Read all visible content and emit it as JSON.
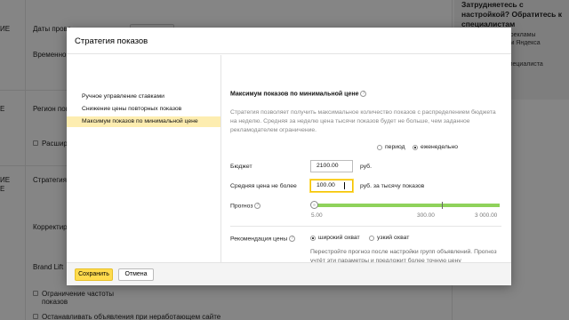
{
  "background": {
    "col1": [
      "ИЕ",
      "Е",
      "ИЕ",
      "Е"
    ],
    "labels": {
      "dates": "Даты прове",
      "time": "Временно",
      "region": "Регион показ",
      "expand": "Расшире",
      "strategy": "Стратегия",
      "adjust": "Корректир",
      "brandlift": "Brand Lift",
      "freq_line1": "Ограничение частоты",
      "freq_line2": "показов",
      "stop": "Останавливать объявления при неработающем сайте"
    },
    "help": {
      "title": "Затрудняетесь с настройкой? Обратитесь к специалистам",
      "item1": "…настройку рекламы специалистам Яндекса",
      "item2": "…частного специалиста"
    }
  },
  "modal": {
    "title": "Стратегия показов",
    "close_glyph": "⊗",
    "strategies": [
      {
        "label": "Ручное управление ставками",
        "active": false
      },
      {
        "label": "Снижение цены повторных показов",
        "active": false
      },
      {
        "label": "Максимум показов по минимальной цене",
        "active": true
      }
    ],
    "right": {
      "title": "Максимум показов по минимальной цене",
      "help_glyph": "?",
      "description": "Стратегия позволяет получить максимальное количество показов с распределением бюджета на неделю. Средняя за неделю цена тысячи показов будет не больше, чем заданное рекламодателем ограничение.",
      "period": {
        "options": [
          {
            "label": "период",
            "selected": false
          },
          {
            "label": "еженедельно",
            "selected": true
          }
        ]
      },
      "budget": {
        "label": "Бюджет",
        "value": "2100.00",
        "unit": "руб."
      },
      "avg_price": {
        "label": "Средняя цена не более",
        "value": "100.00",
        "unit": "руб. за тысячу показов"
      },
      "forecast": {
        "label": "Прогноз",
        "scale_min": "5.00",
        "scale_mid": "300.00",
        "scale_max": "3 000.00",
        "slider_value": 5.0
      },
      "recommendation": {
        "label": "Рекомендация цены",
        "options": [
          {
            "label": "широкий охват",
            "selected": true
          },
          {
            "label": "узкий охват",
            "selected": false
          }
        ],
        "note": "Перестройте прогноз после настройки групп объявлений. Прогноз учтёт эти параметры и предложит более точную цену"
      }
    },
    "footer": {
      "save_label": "Сохранить",
      "cancel_label": "Отмена"
    }
  },
  "colors": {
    "accent_yellow": "#ffdb4d",
    "active_item_bg": "#fdedb0",
    "slider_green": "#8fd25b"
  }
}
